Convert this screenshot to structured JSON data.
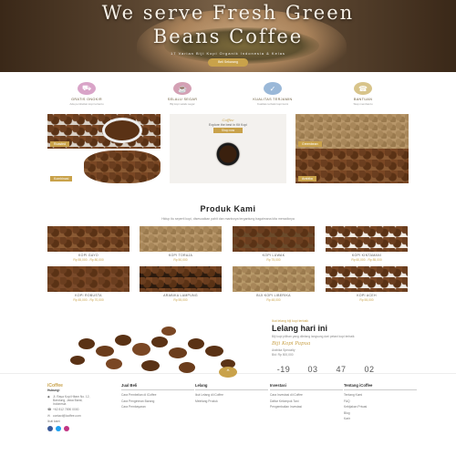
{
  "hero": {
    "title_line1": "We serve Fresh Green",
    "title_line2": "Beans Coffee",
    "subtitle": "17 Varian Biji Kopi Organik Indonesia & Kelas",
    "button": "Beli Sekarang"
  },
  "features": [
    {
      "title": "GRATIS ONGKIR",
      "desc": "Ada pembelian kopi tertentu",
      "color": "#d9a4c8",
      "icon": "truck-icon",
      "glyph": "⛟"
    },
    {
      "title": "SELALU SEGAR",
      "desc": "Biji kopi selalu segar",
      "color": "#d4a0b4",
      "icon": "coffee-cup-icon",
      "glyph": "☕"
    },
    {
      "title": "KUALITAS TERJAMIN",
      "desc": "Kualitas terbaik kopi kami",
      "color": "#9ab8d8",
      "icon": "shield-icon",
      "glyph": "✓"
    },
    {
      "title": "BANTUAN",
      "desc": "Siap membantu",
      "color": "#d8c48a",
      "icon": "support-icon",
      "glyph": "☎"
    }
  ],
  "tiles": {
    "roasted": "Roasted",
    "promo_brand": "Coffee",
    "promo_text": "Explore the best in Kit Kopi",
    "promo_button": "Shop now",
    "greenbean": "Greenbean",
    "kombinasi": "Kombinasi",
    "arabika": "Arabika"
  },
  "products_section": {
    "title": "Produk Kami",
    "subtitle": "Hidup itu seperti kopi, disesuaikan pahit dan manisnya tergantung bagaimana kita meraciknya"
  },
  "products": [
    {
      "name": "KOPI GAYO",
      "price": "Rp 55,000 - Rp 80,000",
      "style": "roasted"
    },
    {
      "name": "KOPI TORAJA",
      "price": "Rp 50,000",
      "style": "green"
    },
    {
      "name": "KOPI LUWAK",
      "price": "Rp 75,000",
      "style": "roasted"
    },
    {
      "name": "KOPI KINTAMANI",
      "price": "Rp 60,000 - Rp 85,000",
      "style": "roasted"
    },
    {
      "name": "KOPI ROBUSTA",
      "price": "Rp 45,000 - Rp 70,000",
      "style": "roasted"
    },
    {
      "name": "ARABIKA LAMPUNG",
      "price": "Rp 55,000",
      "style": "roasted"
    },
    {
      "name": "BIJI KOPI LIBERIKA",
      "price": "Rp 48,000",
      "style": "green"
    },
    {
      "name": "KOPI ACEH",
      "price": "Rp 55,000",
      "style": "roasted"
    }
  ],
  "auction": {
    "kicker": "Ikut lelang biji kopi terbaik",
    "title": "Lelang hari ini",
    "desc": "Biji kopi pilihan yang dilelang langsung dari petani kopi terbaik",
    "item": "Biji Kopi Papua",
    "meta": "Arabika Specialty",
    "bid": "Bid: Rp 500,000",
    "countdown": [
      {
        "value": "-19",
        "label": "Hari"
      },
      {
        "value": "03",
        "label": "Jam"
      },
      {
        "value": "47",
        "label": "Menit"
      },
      {
        "value": "02",
        "label": "Detik"
      }
    ]
  },
  "footer": {
    "brand": "iCoffee",
    "tagline": "Hubungi",
    "address": "Jl. Raya Kopi Hitam No. 12, Bandung, Jawa Barat, Indonesia",
    "phone": "+62 812 7890 0000",
    "email": "contact@icoffee.com",
    "social_label": "Ikuti kami",
    "cols": [
      {
        "h": "Jual Beli",
        "items": [
          "Cara Pembelian di iCoffee",
          "Cara Pengiriman Barang",
          "Cara Pembayaran"
        ]
      },
      {
        "h": "Lelang",
        "items": [
          "Ikut Lelang di iCoffee",
          "Melelang Produk"
        ]
      },
      {
        "h": "Investasi",
        "items": [
          "Cara Investasi di iCoffee",
          "Daftar Kelompok Tani",
          "Pengembalian Investasi"
        ]
      },
      {
        "h": "Tentang iCoffee",
        "items": [
          "Tentang Kami",
          "FAQ",
          "Kebijakan Privasi",
          "Blog",
          "Karir"
        ]
      }
    ]
  },
  "colors": {
    "accent": "#c9a24a",
    "dark": "#3a2818"
  }
}
